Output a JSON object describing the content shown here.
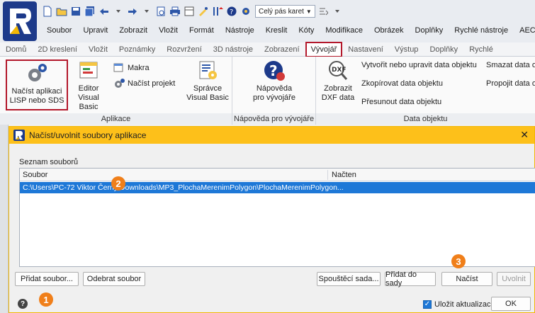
{
  "quick_access": {
    "combo_label": "Celý pás karet"
  },
  "menu": [
    "Soubor",
    "Upravit",
    "Zobrazit",
    "Vložit",
    "Formát",
    "Nástroje",
    "Kreslit",
    "Kóty",
    "Modifikace",
    "Obrázek",
    "Doplňky",
    "Rychlé nástroje",
    "AEC -"
  ],
  "tabs": [
    {
      "label": "Domů",
      "active": false
    },
    {
      "label": "2D kreslení",
      "active": false
    },
    {
      "label": "Vložit",
      "active": false
    },
    {
      "label": "Poznámky",
      "active": false
    },
    {
      "label": "Rozvržení",
      "active": false
    },
    {
      "label": "3D nástroje",
      "active": false
    },
    {
      "label": "Zobrazení",
      "active": false
    },
    {
      "label": "Vývojář",
      "active": true
    },
    {
      "label": "Nastavení",
      "active": false
    },
    {
      "label": "Výstup",
      "active": false
    },
    {
      "label": "Doplňky",
      "active": false
    },
    {
      "label": "Rychlé",
      "active": false
    }
  ],
  "ribbon": {
    "aplikace": {
      "label": "Aplikace",
      "load_app_l1": "Načíst aplikaci",
      "load_app_l2": "LISP nebo SDS",
      "editor_l1": "Editor",
      "editor_l2": "Visual Basic",
      "makra": "Makra",
      "nacist_projekt": "Načíst projekt",
      "spravce_l1": "Správce",
      "spravce_l2": "Visual Basic"
    },
    "napoveda": {
      "label": "Nápověda pro vývojáře",
      "btn_l1": "Nápověda",
      "btn_l2": "pro vývojáře"
    },
    "data_objektu": {
      "label": "Data objektu",
      "dxf_l1": "Zobrazit",
      "dxf_l2": "DXF data",
      "create_edit": "Vytvořit nebo upravit data objektu",
      "copy": "Zkopírovat data objektu",
      "move": "Přesunout data objektu",
      "delete": "Smazat data o",
      "link": "Propojit data o"
    }
  },
  "dialog": {
    "title": "Načíst/uvolnit soubory aplikace",
    "file_list_label": "Seznam souborů",
    "col_file": "Soubor",
    "col_loaded": "Načten",
    "rows": [
      {
        "path": "C:\\Users\\PC-72 Viktor Černý\\Downloads\\MP3_PlochaMerenimPolygon\\PlochaMerenimPolygon..."
      }
    ],
    "buttons": {
      "add_file": "Přidat soubor...",
      "remove_file": "Odebrat soubor",
      "startup_suite": "Spouštěcí sada...",
      "add_to_suite": "Přidat do sady",
      "load": "Načíst",
      "unload": "Uvolnit",
      "ok": "OK"
    },
    "save_updates_label": "Uložit aktualizace",
    "save_updates_checked": true,
    "badges": [
      "1",
      "2",
      "3"
    ]
  },
  "colors": {
    "accent_highlight": "#b3182b",
    "dialog_title": "#fdc01a",
    "selection": "#1e78d7",
    "badge": "#f07f1a"
  }
}
